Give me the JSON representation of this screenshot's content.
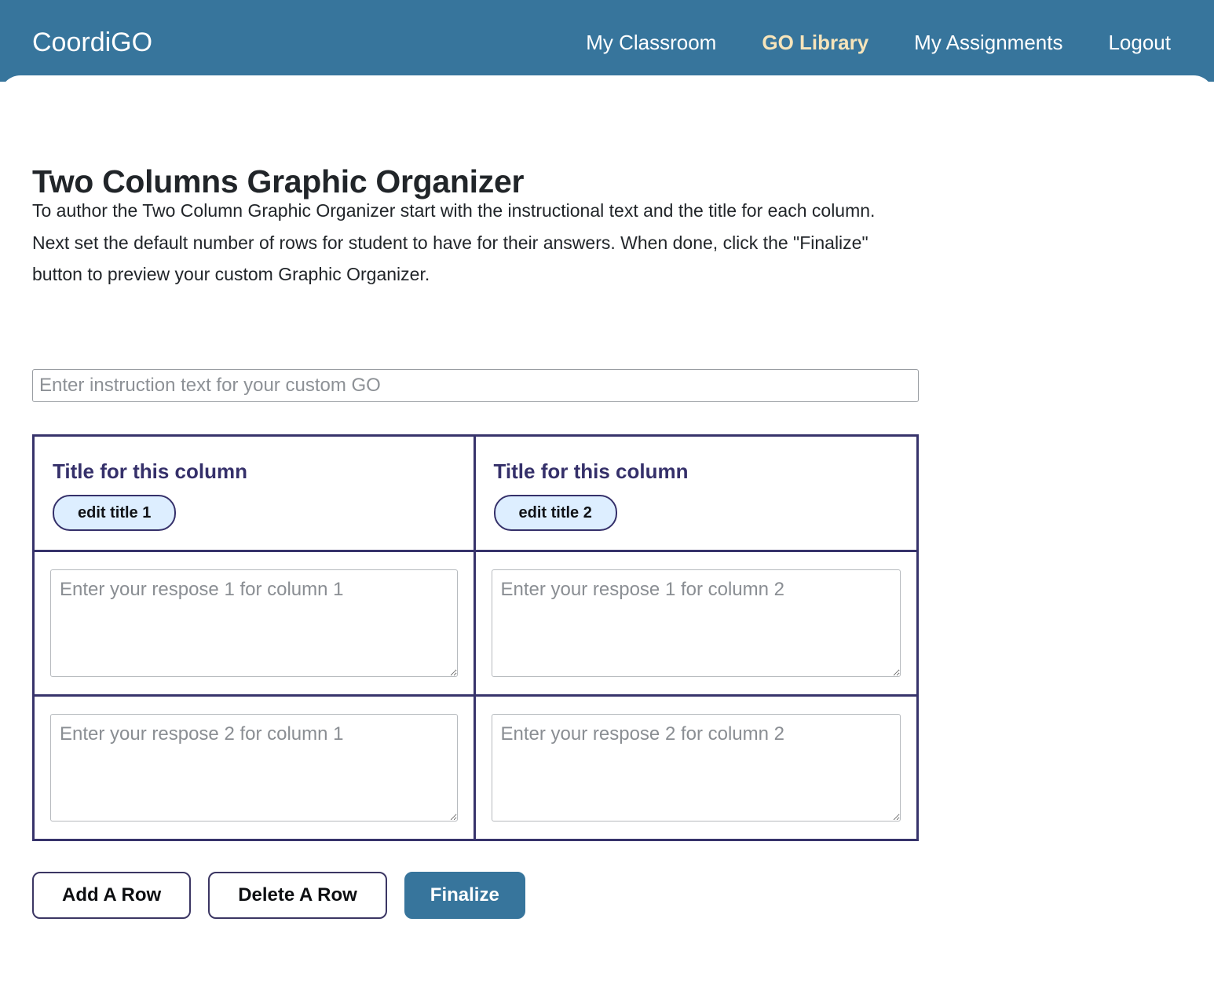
{
  "brand": "CoordiGO",
  "nav": {
    "items": [
      {
        "label": "My Classroom",
        "active": false
      },
      {
        "label": "GO Library",
        "active": true
      },
      {
        "label": "My Assignments",
        "active": false
      },
      {
        "label": "Logout",
        "active": false
      }
    ]
  },
  "page": {
    "title": "Two Columns Graphic Organizer",
    "intro_line_1": "To author the Two Column Graphic Organizer start with the instructional text and the title for each column.",
    "intro_line_2": "Next set the default number of rows for student to have for their answers. When done, click the \"Finalize\" button to preview your custom Graphic Organizer."
  },
  "instruction_field": {
    "placeholder": "Enter instruction text for your custom GO",
    "value": ""
  },
  "organizer": {
    "columns": [
      {
        "title": "Title for this column",
        "edit_button": "edit title 1"
      },
      {
        "title": "Title for this column",
        "edit_button": "edit title 2"
      }
    ],
    "rows": [
      {
        "cells": [
          {
            "placeholder": "Enter your respose 1 for column 1",
            "value": ""
          },
          {
            "placeholder": "Enter your respose 1 for column 2",
            "value": ""
          }
        ]
      },
      {
        "cells": [
          {
            "placeholder": "Enter your respose 2 for column 1",
            "value": ""
          },
          {
            "placeholder": "Enter your respose 2 for column 2",
            "value": ""
          }
        ]
      }
    ]
  },
  "actions": {
    "add_row": "Add A Row",
    "delete_row": "Delete A Row",
    "finalize": "Finalize"
  },
  "colors": {
    "header_teal": "#37759c",
    "nav_active": "#f6e4ba",
    "organizer_border": "#37336b",
    "column_title": "#35306a",
    "edit_button_fill": "#ddeeff",
    "outline_button_border": "#3b3663",
    "primary_button": "#37759c",
    "body_text": "#212529",
    "placeholder_gray": "#8a8e93"
  }
}
